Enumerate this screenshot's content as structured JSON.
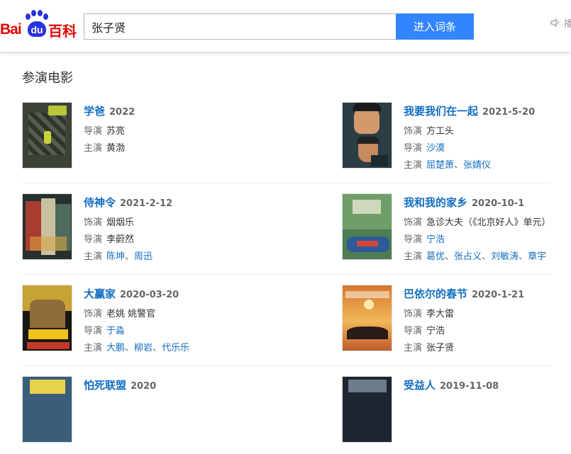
{
  "header": {
    "logo_bai": "Bai",
    "logo_du": "du",
    "logo_baike": "百科",
    "search_value": "张子贤",
    "search_button": "进入词条",
    "side_text": "播"
  },
  "section": {
    "title": "参演电影"
  },
  "films": [
    {
      "title": "学爸",
      "date": "2022",
      "rows": [
        {
          "label": "导演",
          "values": [
            "苏亮"
          ],
          "linked": false
        },
        {
          "label": "主演",
          "values": [
            "黄渤"
          ],
          "linked": false
        }
      ]
    },
    {
      "title": "我要我们在一起",
      "date": "2021-5-20",
      "rows": [
        {
          "label": "饰演",
          "values": [
            "方工头"
          ],
          "linked": false
        },
        {
          "label": "导演",
          "values": [
            "沙漠"
          ],
          "linked": true
        },
        {
          "label": "主演",
          "values": [
            "屈楚萧",
            "张婧仪"
          ],
          "linked": true
        }
      ]
    },
    {
      "title": "侍神令",
      "date": "2021-2-12",
      "rows": [
        {
          "label": "饰演",
          "values": [
            "烟烟乐"
          ],
          "linked": false
        },
        {
          "label": "导演",
          "values": [
            "李蔚然"
          ],
          "linked": false
        },
        {
          "label": "主演",
          "values": [
            "陈坤",
            "周迅"
          ],
          "linked": true
        }
      ]
    },
    {
      "title": "我和我的家乡",
      "date": "2020-10-1",
      "rows": [
        {
          "label": "饰演",
          "values": [
            "急诊大夫（《北京好人》单元）"
          ],
          "linked": false
        },
        {
          "label": "导演",
          "values": [
            "宁浩"
          ],
          "linked": true
        },
        {
          "label": "主演",
          "values": [
            "葛优",
            "张占义",
            "刘敏涛",
            "章宇"
          ],
          "linked": true
        }
      ]
    },
    {
      "title": "大赢家",
      "date": "2020-03-20",
      "rows": [
        {
          "label": "饰演",
          "values": [
            "老姚 姚警官"
          ],
          "linked": false
        },
        {
          "label": "导演",
          "values": [
            "于淼"
          ],
          "linked": true
        },
        {
          "label": "主演",
          "values": [
            "大鹏",
            "柳岩",
            "代乐乐"
          ],
          "linked": true
        }
      ]
    },
    {
      "title": "巴依尔的春节",
      "date": "2020-1-21",
      "rows": [
        {
          "label": "饰演",
          "values": [
            "李大雷"
          ],
          "linked": false
        },
        {
          "label": "导演",
          "values": [
            "宁浩"
          ],
          "linked": false
        },
        {
          "label": "主演",
          "values": [
            "张子贤"
          ],
          "linked": false
        }
      ]
    },
    {
      "title": "怕死联盟",
      "date": "2020",
      "rows": []
    },
    {
      "title": "受益人",
      "date": "2019-11-08",
      "rows": []
    }
  ]
}
